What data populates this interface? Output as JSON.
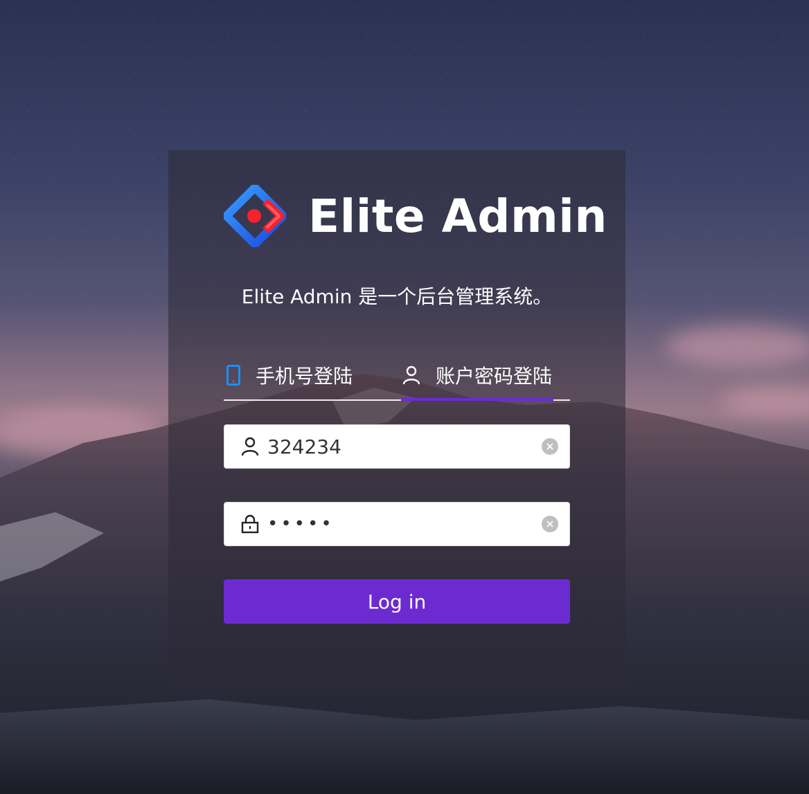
{
  "brand": {
    "title": "Elite Admin",
    "subtitle": "Elite Admin 是一个后台管理系统。"
  },
  "tabs": [
    {
      "label": "手机号登陆",
      "icon": "mobile-icon",
      "active": false
    },
    {
      "label": "账户密码登陆",
      "icon": "user-icon",
      "active": true
    }
  ],
  "form": {
    "username": {
      "value": "324234",
      "icon": "user-icon"
    },
    "password": {
      "value": "•••••",
      "icon": "lock-icon"
    },
    "submit_label": "Log in"
  },
  "colors": {
    "accent": "#6c2bd1",
    "logo_blue": "#1d6cff",
    "logo_red": "#f5222d"
  }
}
